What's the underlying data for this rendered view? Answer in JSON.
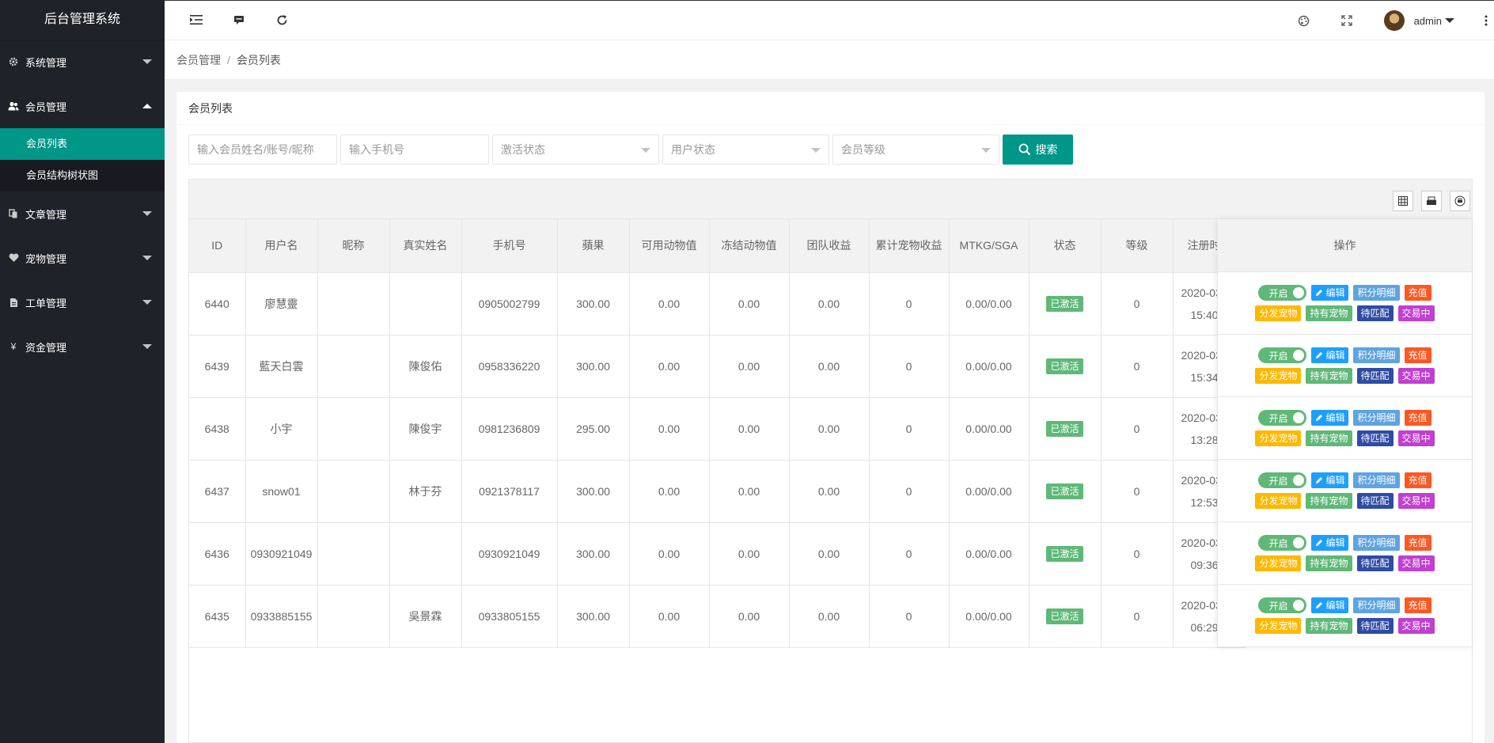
{
  "app": {
    "title": "后台管理系统"
  },
  "sidebar": {
    "items": [
      {
        "label": "系统管理",
        "icon": "gear-icon"
      },
      {
        "label": "会员管理",
        "icon": "users-icon"
      },
      {
        "label": "文章管理",
        "icon": "copy-icon"
      },
      {
        "label": "宠物管理",
        "icon": "heart-icon"
      },
      {
        "label": "工单管理",
        "icon": "file-icon"
      },
      {
        "label": "资金管理",
        "icon": "yen-icon"
      }
    ],
    "sub_items": [
      {
        "label": "会员列表"
      },
      {
        "label": "会员结构树状图"
      }
    ],
    "yen_glyph": "¥"
  },
  "header": {
    "user": "admin"
  },
  "breadcrumb": {
    "parent": "会员管理",
    "sep": "/",
    "current": "会员列表"
  },
  "card": {
    "title": "会员列表"
  },
  "filters": {
    "name_placeholder": "输入会员姓名/账号/昵称",
    "phone_placeholder": "输入手机号",
    "activation_status": "激活状态",
    "user_status": "用户状态",
    "member_level": "会员等级",
    "search_label": "搜索"
  },
  "table": {
    "columns": [
      "ID",
      "用户名",
      "昵称",
      "真实姓名",
      "手机号",
      "蘋果",
      "可用动物值",
      "冻结动物值",
      "团队收益",
      "累计宠物收益",
      "MTKG/SGA",
      "状态",
      "等级",
      "注册时"
    ],
    "op_header": "操作",
    "rows": [
      {
        "id": "6440",
        "username": "廖慧靈",
        "nickname": "",
        "realname": "",
        "phone": "0905002799",
        "apple": "300.00",
        "avail": "0.00",
        "frozen": "0.00",
        "team": "0.00",
        "pet": "0",
        "mtkg": "0.00/0.00",
        "status": "已激活",
        "level": "0",
        "date": "2020-03",
        "time": "15:40:"
      },
      {
        "id": "6439",
        "username": "藍天白雲",
        "nickname": "",
        "realname": "陳俊佑",
        "phone": "0958336220",
        "apple": "300.00",
        "avail": "0.00",
        "frozen": "0.00",
        "team": "0.00",
        "pet": "0",
        "mtkg": "0.00/0.00",
        "status": "已激活",
        "level": "0",
        "date": "2020-03",
        "time": "15:34:"
      },
      {
        "id": "6438",
        "username": "小宇",
        "nickname": "",
        "realname": "陳俊宇",
        "phone": "0981236809",
        "apple": "295.00",
        "avail": "0.00",
        "frozen": "0.00",
        "team": "0.00",
        "pet": "0",
        "mtkg": "0.00/0.00",
        "status": "已激活",
        "level": "0",
        "date": "2020-03",
        "time": "13:28:"
      },
      {
        "id": "6437",
        "username": "snow01",
        "nickname": "",
        "realname": "林于芬",
        "phone": "0921378117",
        "apple": "300.00",
        "avail": "0.00",
        "frozen": "0.00",
        "team": "0.00",
        "pet": "0",
        "mtkg": "0.00/0.00",
        "status": "已激活",
        "level": "0",
        "date": "2020-03",
        "time": "12:53:"
      },
      {
        "id": "6436",
        "username": "0930921049",
        "nickname": "",
        "realname": "",
        "phone": "0930921049",
        "apple": "300.00",
        "avail": "0.00",
        "frozen": "0.00",
        "team": "0.00",
        "pet": "0",
        "mtkg": "0.00/0.00",
        "status": "已激活",
        "level": "0",
        "date": "2020-03",
        "time": "09:36:"
      },
      {
        "id": "6435",
        "username": "0933885155",
        "nickname": "",
        "realname": "吳景霖",
        "phone": "0933805155",
        "apple": "300.00",
        "avail": "0.00",
        "frozen": "0.00",
        "team": "0.00",
        "pet": "0",
        "mtkg": "0.00/0.00",
        "status": "已激活",
        "level": "0",
        "date": "2020-03",
        "time": "06:29:"
      }
    ]
  },
  "ops": {
    "toggle_on": "开启",
    "edit": "编辑",
    "points": "积分明细",
    "recharge": "充值",
    "distribute": "分发宠物",
    "hold": "持有宠物",
    "pending": "待匹配",
    "trading": "交易中"
  },
  "colors": {
    "primary": "#009688",
    "sidebar": "#20222a",
    "active_badge": "#5fb878"
  }
}
